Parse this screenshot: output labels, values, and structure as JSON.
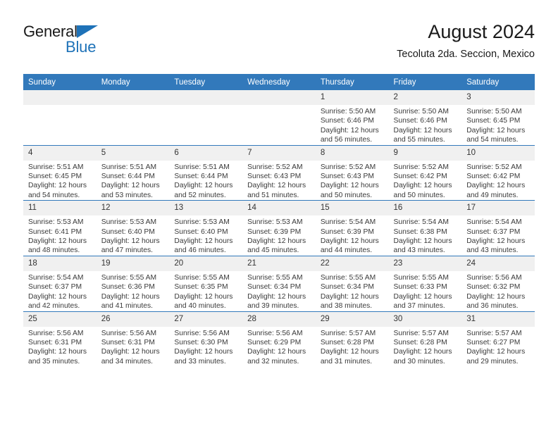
{
  "brand": {
    "line1": "General",
    "line2": "Blue",
    "triangle_color": "#1e72b8"
  },
  "header": {
    "title": "August 2024",
    "subtitle": "Tecoluta 2da. Seccion, Mexico",
    "header_bg": "#3279bb",
    "daynum_bg": "#f0f0f0"
  },
  "calendar": {
    "weekday_headers": [
      "Sunday",
      "Monday",
      "Tuesday",
      "Wednesday",
      "Thursday",
      "Friday",
      "Saturday"
    ],
    "weeks": [
      [
        {
          "day": "",
          "empty": true
        },
        {
          "day": "",
          "empty": true
        },
        {
          "day": "",
          "empty": true
        },
        {
          "day": "",
          "empty": true
        },
        {
          "day": "1",
          "sunrise": "Sunrise: 5:50 AM",
          "sunset": "Sunset: 6:46 PM",
          "daylight1": "Daylight: 12 hours",
          "daylight2": "and 56 minutes."
        },
        {
          "day": "2",
          "sunrise": "Sunrise: 5:50 AM",
          "sunset": "Sunset: 6:46 PM",
          "daylight1": "Daylight: 12 hours",
          "daylight2": "and 55 minutes."
        },
        {
          "day": "3",
          "sunrise": "Sunrise: 5:50 AM",
          "sunset": "Sunset: 6:45 PM",
          "daylight1": "Daylight: 12 hours",
          "daylight2": "and 54 minutes."
        }
      ],
      [
        {
          "day": "4",
          "sunrise": "Sunrise: 5:51 AM",
          "sunset": "Sunset: 6:45 PM",
          "daylight1": "Daylight: 12 hours",
          "daylight2": "and 54 minutes."
        },
        {
          "day": "5",
          "sunrise": "Sunrise: 5:51 AM",
          "sunset": "Sunset: 6:44 PM",
          "daylight1": "Daylight: 12 hours",
          "daylight2": "and 53 minutes."
        },
        {
          "day": "6",
          "sunrise": "Sunrise: 5:51 AM",
          "sunset": "Sunset: 6:44 PM",
          "daylight1": "Daylight: 12 hours",
          "daylight2": "and 52 minutes."
        },
        {
          "day": "7",
          "sunrise": "Sunrise: 5:52 AM",
          "sunset": "Sunset: 6:43 PM",
          "daylight1": "Daylight: 12 hours",
          "daylight2": "and 51 minutes."
        },
        {
          "day": "8",
          "sunrise": "Sunrise: 5:52 AM",
          "sunset": "Sunset: 6:43 PM",
          "daylight1": "Daylight: 12 hours",
          "daylight2": "and 50 minutes."
        },
        {
          "day": "9",
          "sunrise": "Sunrise: 5:52 AM",
          "sunset": "Sunset: 6:42 PM",
          "daylight1": "Daylight: 12 hours",
          "daylight2": "and 50 minutes."
        },
        {
          "day": "10",
          "sunrise": "Sunrise: 5:52 AM",
          "sunset": "Sunset: 6:42 PM",
          "daylight1": "Daylight: 12 hours",
          "daylight2": "and 49 minutes."
        }
      ],
      [
        {
          "day": "11",
          "sunrise": "Sunrise: 5:53 AM",
          "sunset": "Sunset: 6:41 PM",
          "daylight1": "Daylight: 12 hours",
          "daylight2": "and 48 minutes."
        },
        {
          "day": "12",
          "sunrise": "Sunrise: 5:53 AM",
          "sunset": "Sunset: 6:40 PM",
          "daylight1": "Daylight: 12 hours",
          "daylight2": "and 47 minutes."
        },
        {
          "day": "13",
          "sunrise": "Sunrise: 5:53 AM",
          "sunset": "Sunset: 6:40 PM",
          "daylight1": "Daylight: 12 hours",
          "daylight2": "and 46 minutes."
        },
        {
          "day": "14",
          "sunrise": "Sunrise: 5:53 AM",
          "sunset": "Sunset: 6:39 PM",
          "daylight1": "Daylight: 12 hours",
          "daylight2": "and 45 minutes."
        },
        {
          "day": "15",
          "sunrise": "Sunrise: 5:54 AM",
          "sunset": "Sunset: 6:39 PM",
          "daylight1": "Daylight: 12 hours",
          "daylight2": "and 44 minutes."
        },
        {
          "day": "16",
          "sunrise": "Sunrise: 5:54 AM",
          "sunset": "Sunset: 6:38 PM",
          "daylight1": "Daylight: 12 hours",
          "daylight2": "and 43 minutes."
        },
        {
          "day": "17",
          "sunrise": "Sunrise: 5:54 AM",
          "sunset": "Sunset: 6:37 PM",
          "daylight1": "Daylight: 12 hours",
          "daylight2": "and 43 minutes."
        }
      ],
      [
        {
          "day": "18",
          "sunrise": "Sunrise: 5:54 AM",
          "sunset": "Sunset: 6:37 PM",
          "daylight1": "Daylight: 12 hours",
          "daylight2": "and 42 minutes."
        },
        {
          "day": "19",
          "sunrise": "Sunrise: 5:55 AM",
          "sunset": "Sunset: 6:36 PM",
          "daylight1": "Daylight: 12 hours",
          "daylight2": "and 41 minutes."
        },
        {
          "day": "20",
          "sunrise": "Sunrise: 5:55 AM",
          "sunset": "Sunset: 6:35 PM",
          "daylight1": "Daylight: 12 hours",
          "daylight2": "and 40 minutes."
        },
        {
          "day": "21",
          "sunrise": "Sunrise: 5:55 AM",
          "sunset": "Sunset: 6:34 PM",
          "daylight1": "Daylight: 12 hours",
          "daylight2": "and 39 minutes."
        },
        {
          "day": "22",
          "sunrise": "Sunrise: 5:55 AM",
          "sunset": "Sunset: 6:34 PM",
          "daylight1": "Daylight: 12 hours",
          "daylight2": "and 38 minutes."
        },
        {
          "day": "23",
          "sunrise": "Sunrise: 5:55 AM",
          "sunset": "Sunset: 6:33 PM",
          "daylight1": "Daylight: 12 hours",
          "daylight2": "and 37 minutes."
        },
        {
          "day": "24",
          "sunrise": "Sunrise: 5:56 AM",
          "sunset": "Sunset: 6:32 PM",
          "daylight1": "Daylight: 12 hours",
          "daylight2": "and 36 minutes."
        }
      ],
      [
        {
          "day": "25",
          "sunrise": "Sunrise: 5:56 AM",
          "sunset": "Sunset: 6:31 PM",
          "daylight1": "Daylight: 12 hours",
          "daylight2": "and 35 minutes."
        },
        {
          "day": "26",
          "sunrise": "Sunrise: 5:56 AM",
          "sunset": "Sunset: 6:31 PM",
          "daylight1": "Daylight: 12 hours",
          "daylight2": "and 34 minutes."
        },
        {
          "day": "27",
          "sunrise": "Sunrise: 5:56 AM",
          "sunset": "Sunset: 6:30 PM",
          "daylight1": "Daylight: 12 hours",
          "daylight2": "and 33 minutes."
        },
        {
          "day": "28",
          "sunrise": "Sunrise: 5:56 AM",
          "sunset": "Sunset: 6:29 PM",
          "daylight1": "Daylight: 12 hours",
          "daylight2": "and 32 minutes."
        },
        {
          "day": "29",
          "sunrise": "Sunrise: 5:57 AM",
          "sunset": "Sunset: 6:28 PM",
          "daylight1": "Daylight: 12 hours",
          "daylight2": "and 31 minutes."
        },
        {
          "day": "30",
          "sunrise": "Sunrise: 5:57 AM",
          "sunset": "Sunset: 6:28 PM",
          "daylight1": "Daylight: 12 hours",
          "daylight2": "and 30 minutes."
        },
        {
          "day": "31",
          "sunrise": "Sunrise: 5:57 AM",
          "sunset": "Sunset: 6:27 PM",
          "daylight1": "Daylight: 12 hours",
          "daylight2": "and 29 minutes."
        }
      ]
    ]
  }
}
